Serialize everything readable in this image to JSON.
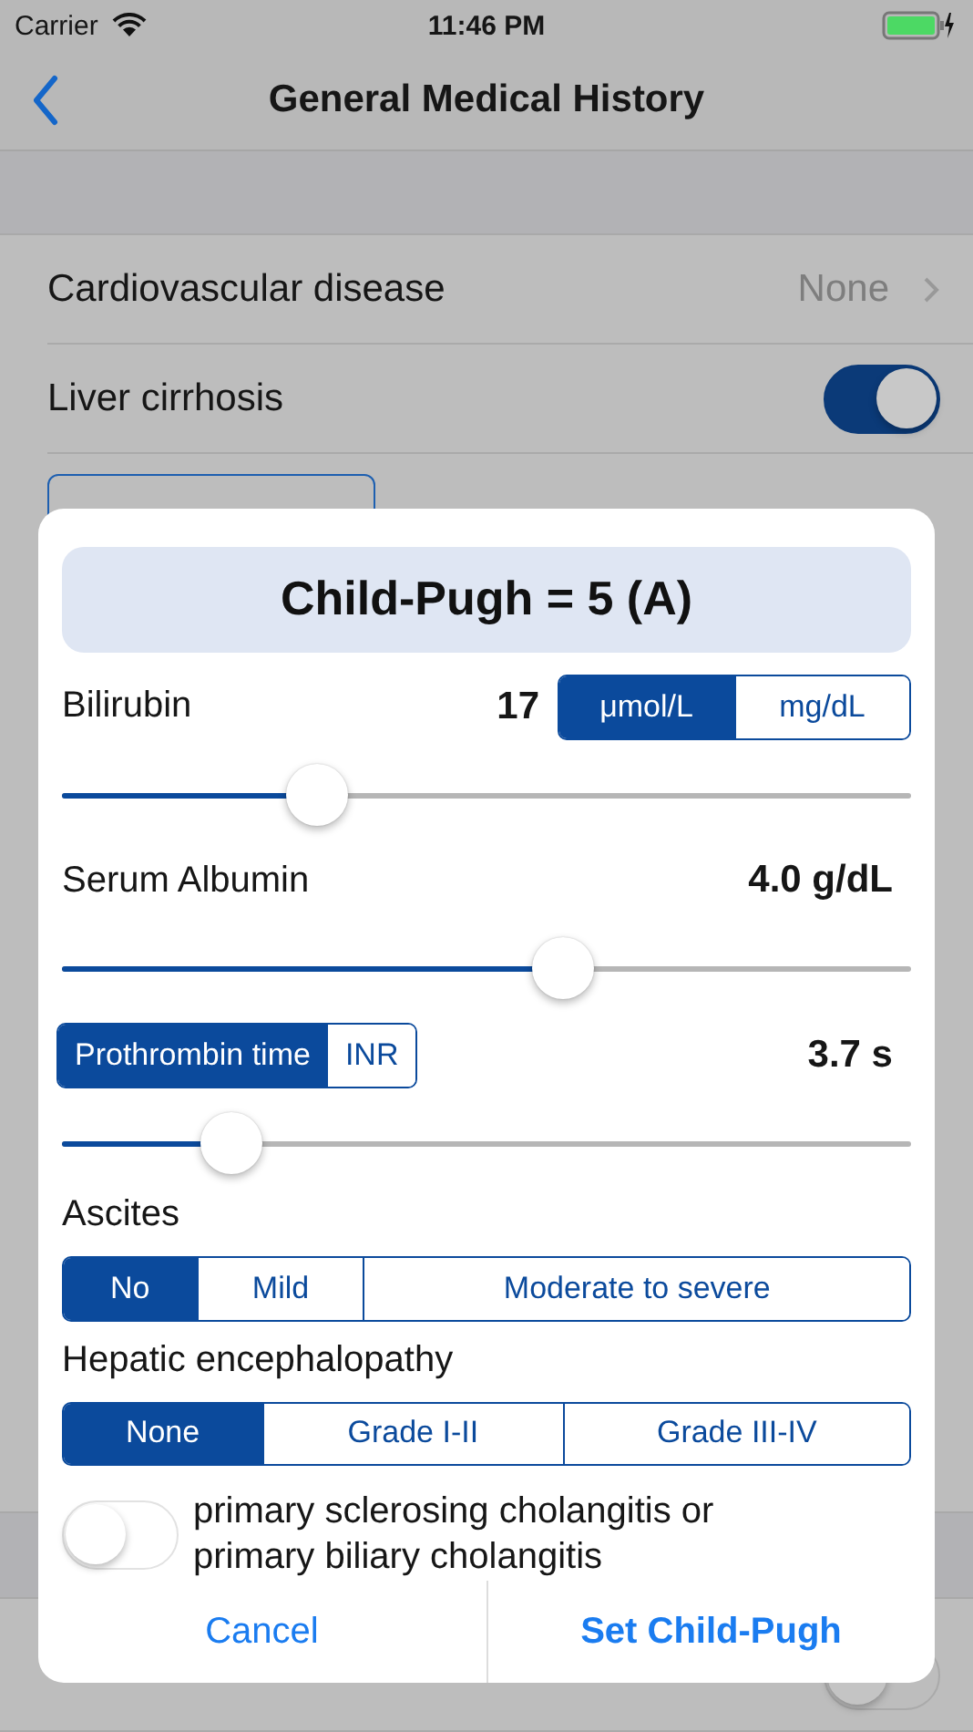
{
  "status_bar": {
    "carrier": "Carrier",
    "time": "11:46 PM"
  },
  "nav": {
    "title": "General Medical History"
  },
  "rows": [
    {
      "kind": "disclosure",
      "label": "Cardiovascular disease",
      "value": "None"
    },
    {
      "kind": "toggle",
      "label": "Liver cirrhosis",
      "on": true
    }
  ],
  "bottom_row": {
    "on": false
  },
  "dialog": {
    "result": "Child-Pugh = 5 (A)",
    "parameters": [
      {
        "label": "Bilirubin",
        "value": "17",
        "units": [
          {
            "label": "μmol/L",
            "selected": true
          },
          {
            "label": "mg/dL",
            "selected": false
          }
        ],
        "level": 0.3
      },
      {
        "label": "Serum Albumin",
        "value": "4.0 g/dL",
        "level": 0.59
      },
      {
        "value": "3.7 s",
        "modes": [
          {
            "label": "Prothrombin time",
            "selected": true
          },
          {
            "label": "INR",
            "selected": false
          }
        ],
        "level": 0.2
      }
    ],
    "choices": [
      {
        "label": "Ascites",
        "options": [
          {
            "label": "No",
            "selected": true
          },
          {
            "label": "Mild",
            "selected": false
          },
          {
            "label": "Moderate to severe",
            "selected": false
          }
        ]
      },
      {
        "label": "Hepatic encephalopathy",
        "options": [
          {
            "label": "None",
            "selected": true
          },
          {
            "label": "Grade I-II",
            "selected": false
          },
          {
            "label": "Grade III-IV",
            "selected": false
          }
        ]
      }
    ],
    "switch": {
      "label": "primary sclerosing cholangitis or primary biliary cholangitis",
      "on": false
    },
    "buttons": [
      {
        "label": "Cancel",
        "primary": false
      },
      {
        "label": "Set Child-Pugh",
        "primary": true
      }
    ]
  }
}
